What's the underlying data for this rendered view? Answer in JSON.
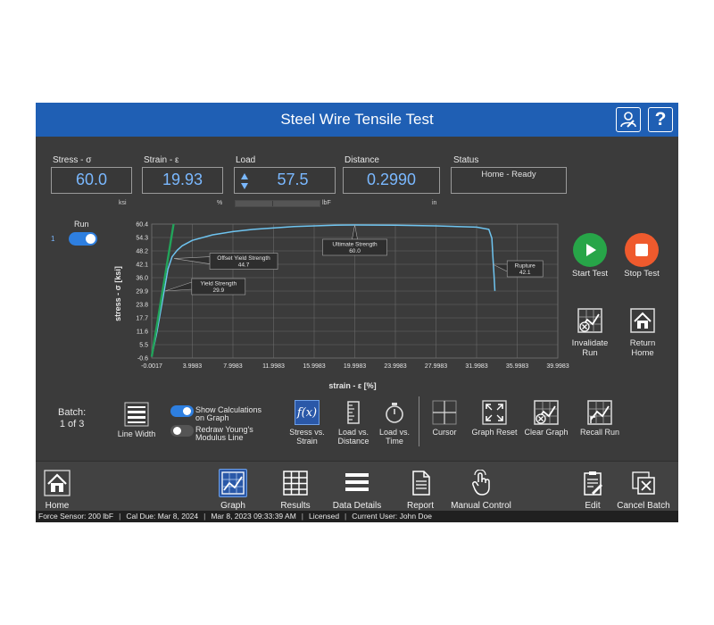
{
  "window": {
    "title": "Steel Wire Tensile Test"
  },
  "readouts": {
    "stress": {
      "label": "Stress - σ",
      "value": "60.0",
      "unit": "ksi"
    },
    "strain": {
      "label": "Strain - ε",
      "value": "19.93",
      "unit": "%"
    },
    "load": {
      "label": "Load",
      "value": "57.5",
      "unit": "lbF"
    },
    "distance": {
      "label": "Distance",
      "value": "0.2990",
      "unit": "in"
    },
    "status": {
      "label": "Status",
      "value": "Home - Ready"
    }
  },
  "run": {
    "label": "Run",
    "index": "1",
    "enabled": true
  },
  "chart_data": {
    "type": "line",
    "xlabel": "strain - ε [%]",
    "ylabel": "stress - σ [ksi]",
    "xlim": [
      -0.0017,
      39.9983
    ],
    "ylim": [
      -0.6,
      60.4
    ],
    "x_ticks": [
      "-0.0017",
      "3.9983",
      "7.9983",
      "11.9983",
      "15.9983",
      "19.9983",
      "23.9983",
      "27.9983",
      "31.9983",
      "35.9983",
      "39.9983"
    ],
    "y_ticks": [
      "60.4",
      "54.3",
      "48.2",
      "42.1",
      "36.0",
      "29.9",
      "23.8",
      "17.7",
      "11.6",
      "5.5",
      "-0.6"
    ],
    "grid": true,
    "series": [
      {
        "color": "#6ec4f0",
        "x": [
          0,
          0.5,
          1.0,
          1.3,
          1.6,
          2.0,
          2.5,
          3.0,
          4.0,
          6.0,
          8.0,
          10.0,
          14.0,
          18.0,
          20.0,
          24.0,
          28.0,
          32.0,
          33.2,
          33.5,
          33.6,
          33.7,
          33.8
        ],
        "y": [
          0,
          11.0,
          24.0,
          32.0,
          40.0,
          45.5,
          48.5,
          50.5,
          53.0,
          55.5,
          57.0,
          58.0,
          59.3,
          59.9,
          60.0,
          59.9,
          59.6,
          59.0,
          58.0,
          54.0,
          46.0,
          38.0,
          30.0
        ]
      },
      {
        "color": "#22a35a",
        "x": [
          0,
          2.15
        ],
        "y": [
          0,
          60.4
        ]
      }
    ],
    "annotations": [
      {
        "label": "Offset Yield Strength",
        "value": "44.7",
        "x": 2.2,
        "y": 44.7
      },
      {
        "label": "Yield Strength",
        "value": "29.9",
        "x": 1.3,
        "y": 29.9
      },
      {
        "label": "Ultimate Strength",
        "value": "60.0",
        "x": 20.0,
        "y": 60.0
      },
      {
        "label": "Rupture",
        "value": "42.1",
        "x": 33.6,
        "y": 42.1
      }
    ]
  },
  "controls": {
    "start": {
      "label": "Start Test",
      "color": "#27a548"
    },
    "stop": {
      "label": "Stop Test",
      "color": "#ef5a2d"
    },
    "invalidate": {
      "label": "Invalidate Run"
    },
    "return_home": {
      "label": "Return Home"
    }
  },
  "batch": {
    "label": "Batch:",
    "position": "1 of 3"
  },
  "tools": {
    "line_width": "Line Width",
    "show_calculations": {
      "label": "Show Calculations on Graph",
      "enabled": true
    },
    "redraw_modulus": {
      "label": "Redraw Young's Modulus Line",
      "enabled": false
    },
    "stress_vs_strain": "Stress vs. Strain",
    "load_vs_distance": "Load vs. Distance",
    "load_vs_time": "Load vs. Time",
    "cursor": "Cursor",
    "graph_reset": "Graph Reset",
    "clear_graph": "Clear Graph",
    "recall_run": "Recall Run"
  },
  "nav": {
    "home": "Home",
    "graph": "Graph",
    "results": "Results",
    "data_details": "Data Details",
    "report": "Report",
    "manual_control": "Manual Control",
    "edit": "Edit",
    "cancel_batch": "Cancel Batch",
    "active": "graph"
  },
  "statusbar": {
    "force_sensor": "Force Sensor: 200 lbF",
    "cal_due": "Cal Due: Mar 8, 2024",
    "datetime": "Mar 8, 2023 09:33:39 AM",
    "license": "Licensed",
    "current_user": "Current User: John Doe"
  },
  "colors": {
    "accent": "#1f5fb4",
    "value_text": "#7ab8ff",
    "panel": "#3b3b3b"
  }
}
